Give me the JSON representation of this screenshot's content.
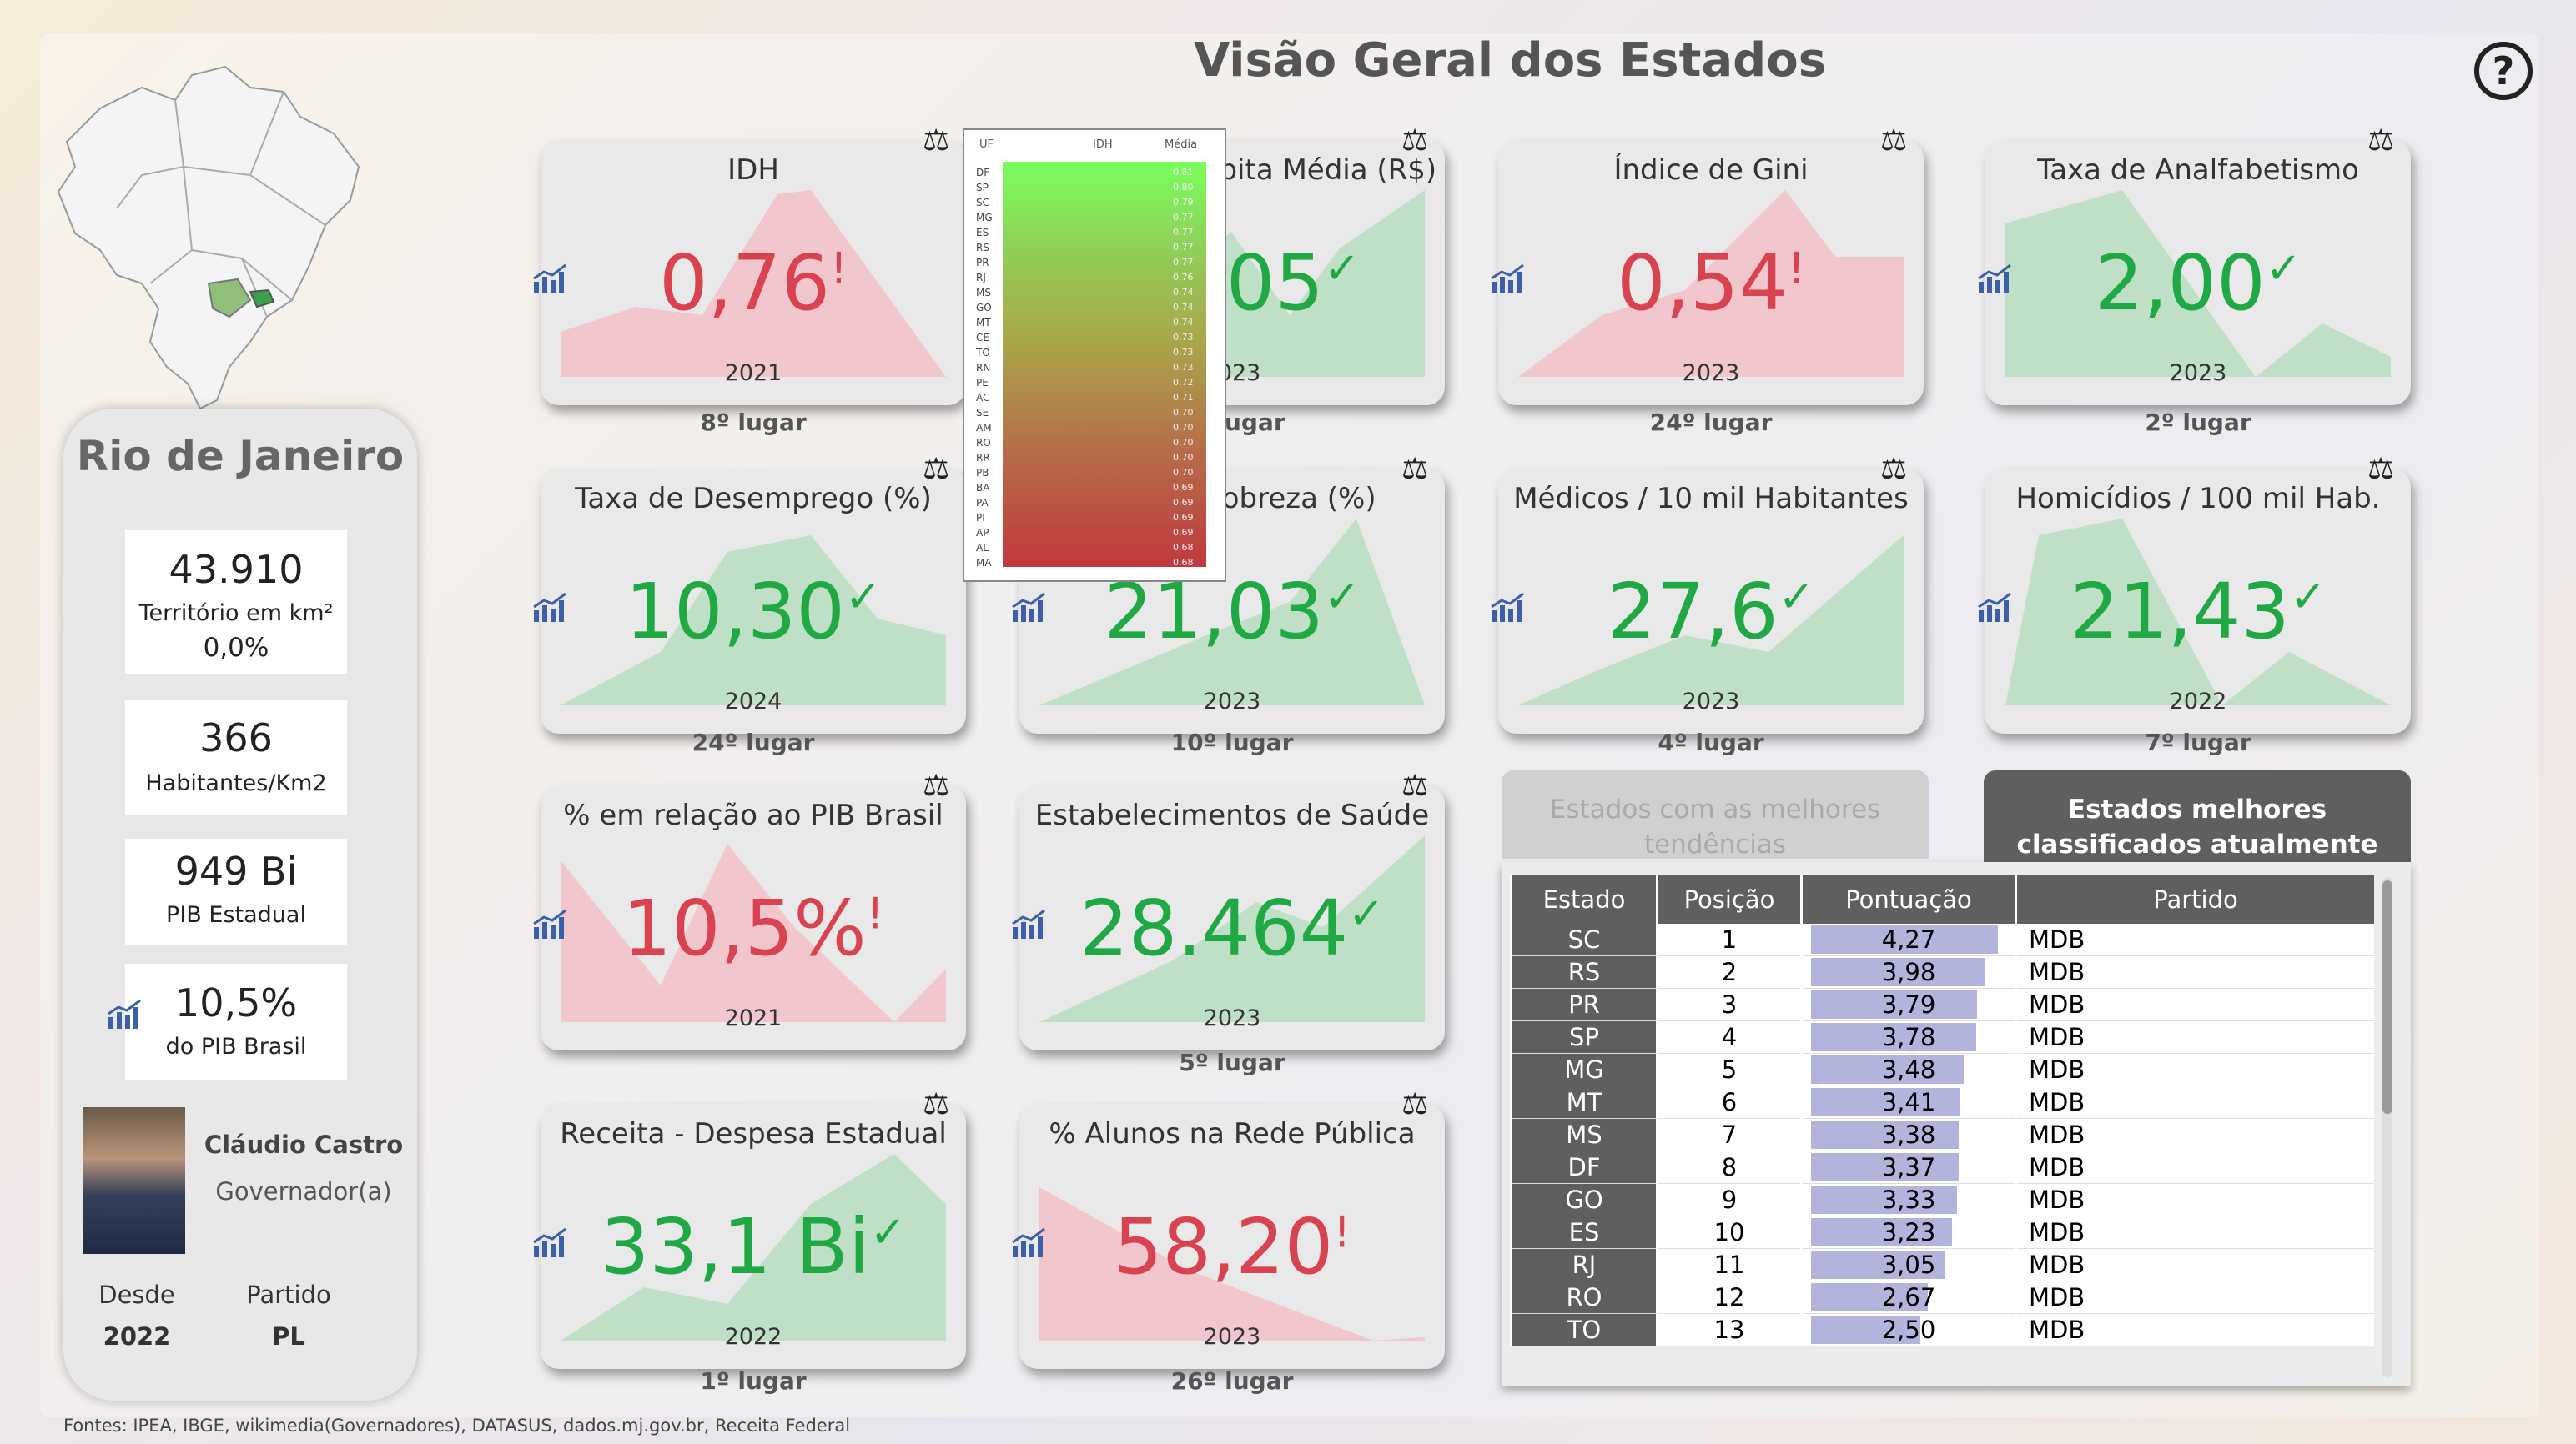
{
  "title": "Visão Geral dos Estados",
  "help_glyph": "?",
  "state": "Rio de Janeiro",
  "stats": [
    {
      "value": "43.910",
      "label": "Território em km²",
      "sub": "0,0%"
    },
    {
      "value": "366",
      "label": "Habitantes/Km2"
    },
    {
      "value": "949 Bi",
      "label": "PIB Estadual"
    },
    {
      "value": "10,5%",
      "label": "do PIB Brasil"
    }
  ],
  "governor": {
    "name": "Cláudio Castro",
    "role": "Governador(a)",
    "since_label": "Desde",
    "since": "2022",
    "party_label": "Partido",
    "party": "PL"
  },
  "cards": [
    {
      "title": "IDH",
      "value": "0,76",
      "mark": "!",
      "year": "2021",
      "rank": "8º lugar",
      "status": "bad"
    },
    {
      "title": "Renda per Capita Média (R$)",
      "value": "2.305",
      "mark": "✓",
      "year": "2023",
      "rank": "4º lugar",
      "status": "good"
    },
    {
      "title": "Índice de Gini",
      "value": "0,54",
      "mark": "!",
      "year": "2023",
      "rank": "24º lugar",
      "status": "bad"
    },
    {
      "title": "Taxa de Analfabetismo",
      "value": "2,00",
      "mark": "✓",
      "year": "2023",
      "rank": "2º lugar",
      "status": "good"
    },
    {
      "title": "Taxa de Desemprego (%)",
      "value": "10,30",
      "mark": "✓",
      "year": "2024",
      "rank": "24º lugar",
      "status": "good"
    },
    {
      "title": "Taxa de Pobreza (%)",
      "value": "21,03",
      "mark": "✓",
      "year": "2023",
      "rank": "10º lugar",
      "status": "good"
    },
    {
      "title": "Médicos / 10 mil Habitantes",
      "value": "27,6",
      "mark": "✓",
      "year": "2023",
      "rank": "4º lugar",
      "status": "good"
    },
    {
      "title": "Homicídios / 100 mil Hab.",
      "value": "21,43",
      "mark": "✓",
      "year": "2022",
      "rank": "7º lugar",
      "status": "good"
    },
    {
      "title": "% em relação ao PIB Brasil",
      "value": "10,5%",
      "mark": "!",
      "year": "2021",
      "rank": "",
      "status": "bad"
    },
    {
      "title": "Estabelecimentos de Saúde",
      "value": "28.464",
      "mark": "✓",
      "year": "2023",
      "rank": "5º lugar",
      "status": "good"
    },
    {
      "title": "Receita - Despesa Estadual",
      "value": "33,1 Bi",
      "mark": "✓",
      "year": "2022",
      "rank": "1º lugar",
      "status": "good"
    },
    {
      "title": "% Alunos na Rede Pública",
      "value": "58,20",
      "mark": "!",
      "year": "2023",
      "rank": "26º lugar",
      "status": "bad"
    }
  ],
  "popup": {
    "headers": [
      "UF",
      "IDH",
      "Média"
    ],
    "rows": [
      [
        "DF",
        "0,81"
      ],
      [
        "SP",
        "0,80"
      ],
      [
        "SC",
        "0,79"
      ],
      [
        "MG",
        "0,77"
      ],
      [
        "ES",
        "0,77"
      ],
      [
        "RS",
        "0,77"
      ],
      [
        "PR",
        "0,77"
      ],
      [
        "RJ",
        "0,76"
      ],
      [
        "MS",
        "0,74"
      ],
      [
        "GO",
        "0,74"
      ],
      [
        "MT",
        "0,74"
      ],
      [
        "CE",
        "0,73"
      ],
      [
        "TO",
        "0,73"
      ],
      [
        "RN",
        "0,73"
      ],
      [
        "PE",
        "0,72"
      ],
      [
        "AC",
        "0,71"
      ],
      [
        "SE",
        "0,70"
      ],
      [
        "AM",
        "0,70"
      ],
      [
        "RO",
        "0,70"
      ],
      [
        "RR",
        "0,70"
      ],
      [
        "PB",
        "0,70"
      ],
      [
        "BA",
        "0,69"
      ],
      [
        "PA",
        "0,69"
      ],
      [
        "PI",
        "0,69"
      ],
      [
        "AP",
        "0,69"
      ],
      [
        "AL",
        "0,68"
      ],
      [
        "MA",
        "0,68"
      ]
    ]
  },
  "tabs": {
    "trends": "Estados com as melhores tendências",
    "best": "Estados melhores classificados atualmente"
  },
  "table": {
    "headers": [
      "Estado",
      "Posição",
      "Pontuação",
      "Partido"
    ],
    "rows": [
      {
        "estado": "SC",
        "posicao": "1",
        "pontuacao": "4,27",
        "partido": "MDB"
      },
      {
        "estado": "RS",
        "posicao": "2",
        "pontuacao": "3,98",
        "partido": "MDB"
      },
      {
        "estado": "PR",
        "posicao": "3",
        "pontuacao": "3,79",
        "partido": "MDB"
      },
      {
        "estado": "SP",
        "posicao": "4",
        "pontuacao": "3,78",
        "partido": "MDB"
      },
      {
        "estado": "MG",
        "posicao": "5",
        "pontuacao": "3,48",
        "partido": "MDB"
      },
      {
        "estado": "MT",
        "posicao": "6",
        "pontuacao": "3,41",
        "partido": "MDB"
      },
      {
        "estado": "MS",
        "posicao": "7",
        "pontuacao": "3,38",
        "partido": "MDB"
      },
      {
        "estado": "DF",
        "posicao": "8",
        "pontuacao": "3,37",
        "partido": "MDB"
      },
      {
        "estado": "GO",
        "posicao": "9",
        "pontuacao": "3,33",
        "partido": "MDB"
      },
      {
        "estado": "ES",
        "posicao": "10",
        "pontuacao": "3,23",
        "partido": "MDB"
      },
      {
        "estado": "RJ",
        "posicao": "11",
        "pontuacao": "3,05",
        "partido": "MDB"
      },
      {
        "estado": "RO",
        "posicao": "12",
        "pontuacao": "2,67",
        "partido": "MDB"
      },
      {
        "estado": "TO",
        "posicao": "13",
        "pontuacao": "2,50",
        "partido": "MDB"
      }
    ]
  },
  "source": "Fontes: IPEA, IBGE, wikimedia(Governadores), DATASUS, dados.mj.gov.br, Receita Federal",
  "colors": {
    "good": "#20a845",
    "bad": "#d9434f",
    "good_fill": "#bfe0c6",
    "bad_fill": "#f1c6cc",
    "bar": "#b3b4dc"
  }
}
